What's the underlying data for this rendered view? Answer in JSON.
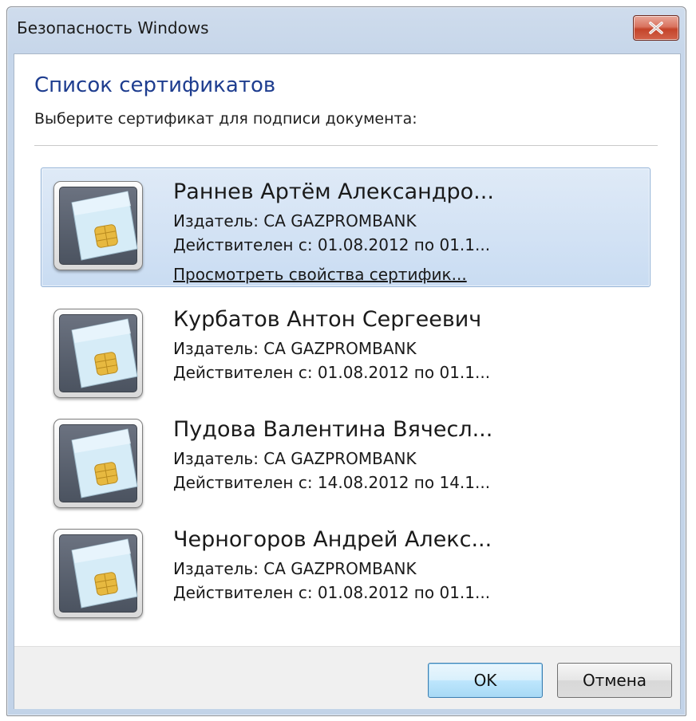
{
  "window": {
    "title": "Безопасность Windows"
  },
  "dialog": {
    "heading": "Список сертификатов",
    "subheading": "Выберите сертификат для подписи документа:"
  },
  "certificates": [
    {
      "name": "Раннев Артём Александро...",
      "issuer": "Издатель: CA GAZPROMBANK",
      "valid": "Действителен с: 01.08.2012 по 01.1...",
      "link": "Просмотреть свойства сертифик...",
      "selected": true
    },
    {
      "name": "Курбатов Антон Сергеевич",
      "issuer": "Издатель: CA GAZPROMBANK",
      "valid": "Действителен с: 01.08.2012 по 01.1...",
      "selected": false
    },
    {
      "name": "Пудова Валентина Вячесл...",
      "issuer": "Издатель: CA GAZPROMBANK",
      "valid": "Действителен с: 14.08.2012 по 14.1...",
      "selected": false
    },
    {
      "name": "Черногоров Андрей Алекс...",
      "issuer": "Издатель: CA GAZPROMBANK",
      "valid": "Действителен с: 01.08.2012 по 01.1...",
      "selected": false
    }
  ],
  "buttons": {
    "ok": "OK",
    "cancel": "Отмена"
  },
  "icons": {
    "card": "smart-card-icon",
    "close": "close-icon"
  },
  "colors": {
    "heading": "#1e3d8f",
    "selection": "#c9dcf2",
    "close_button": "#c4442a"
  }
}
